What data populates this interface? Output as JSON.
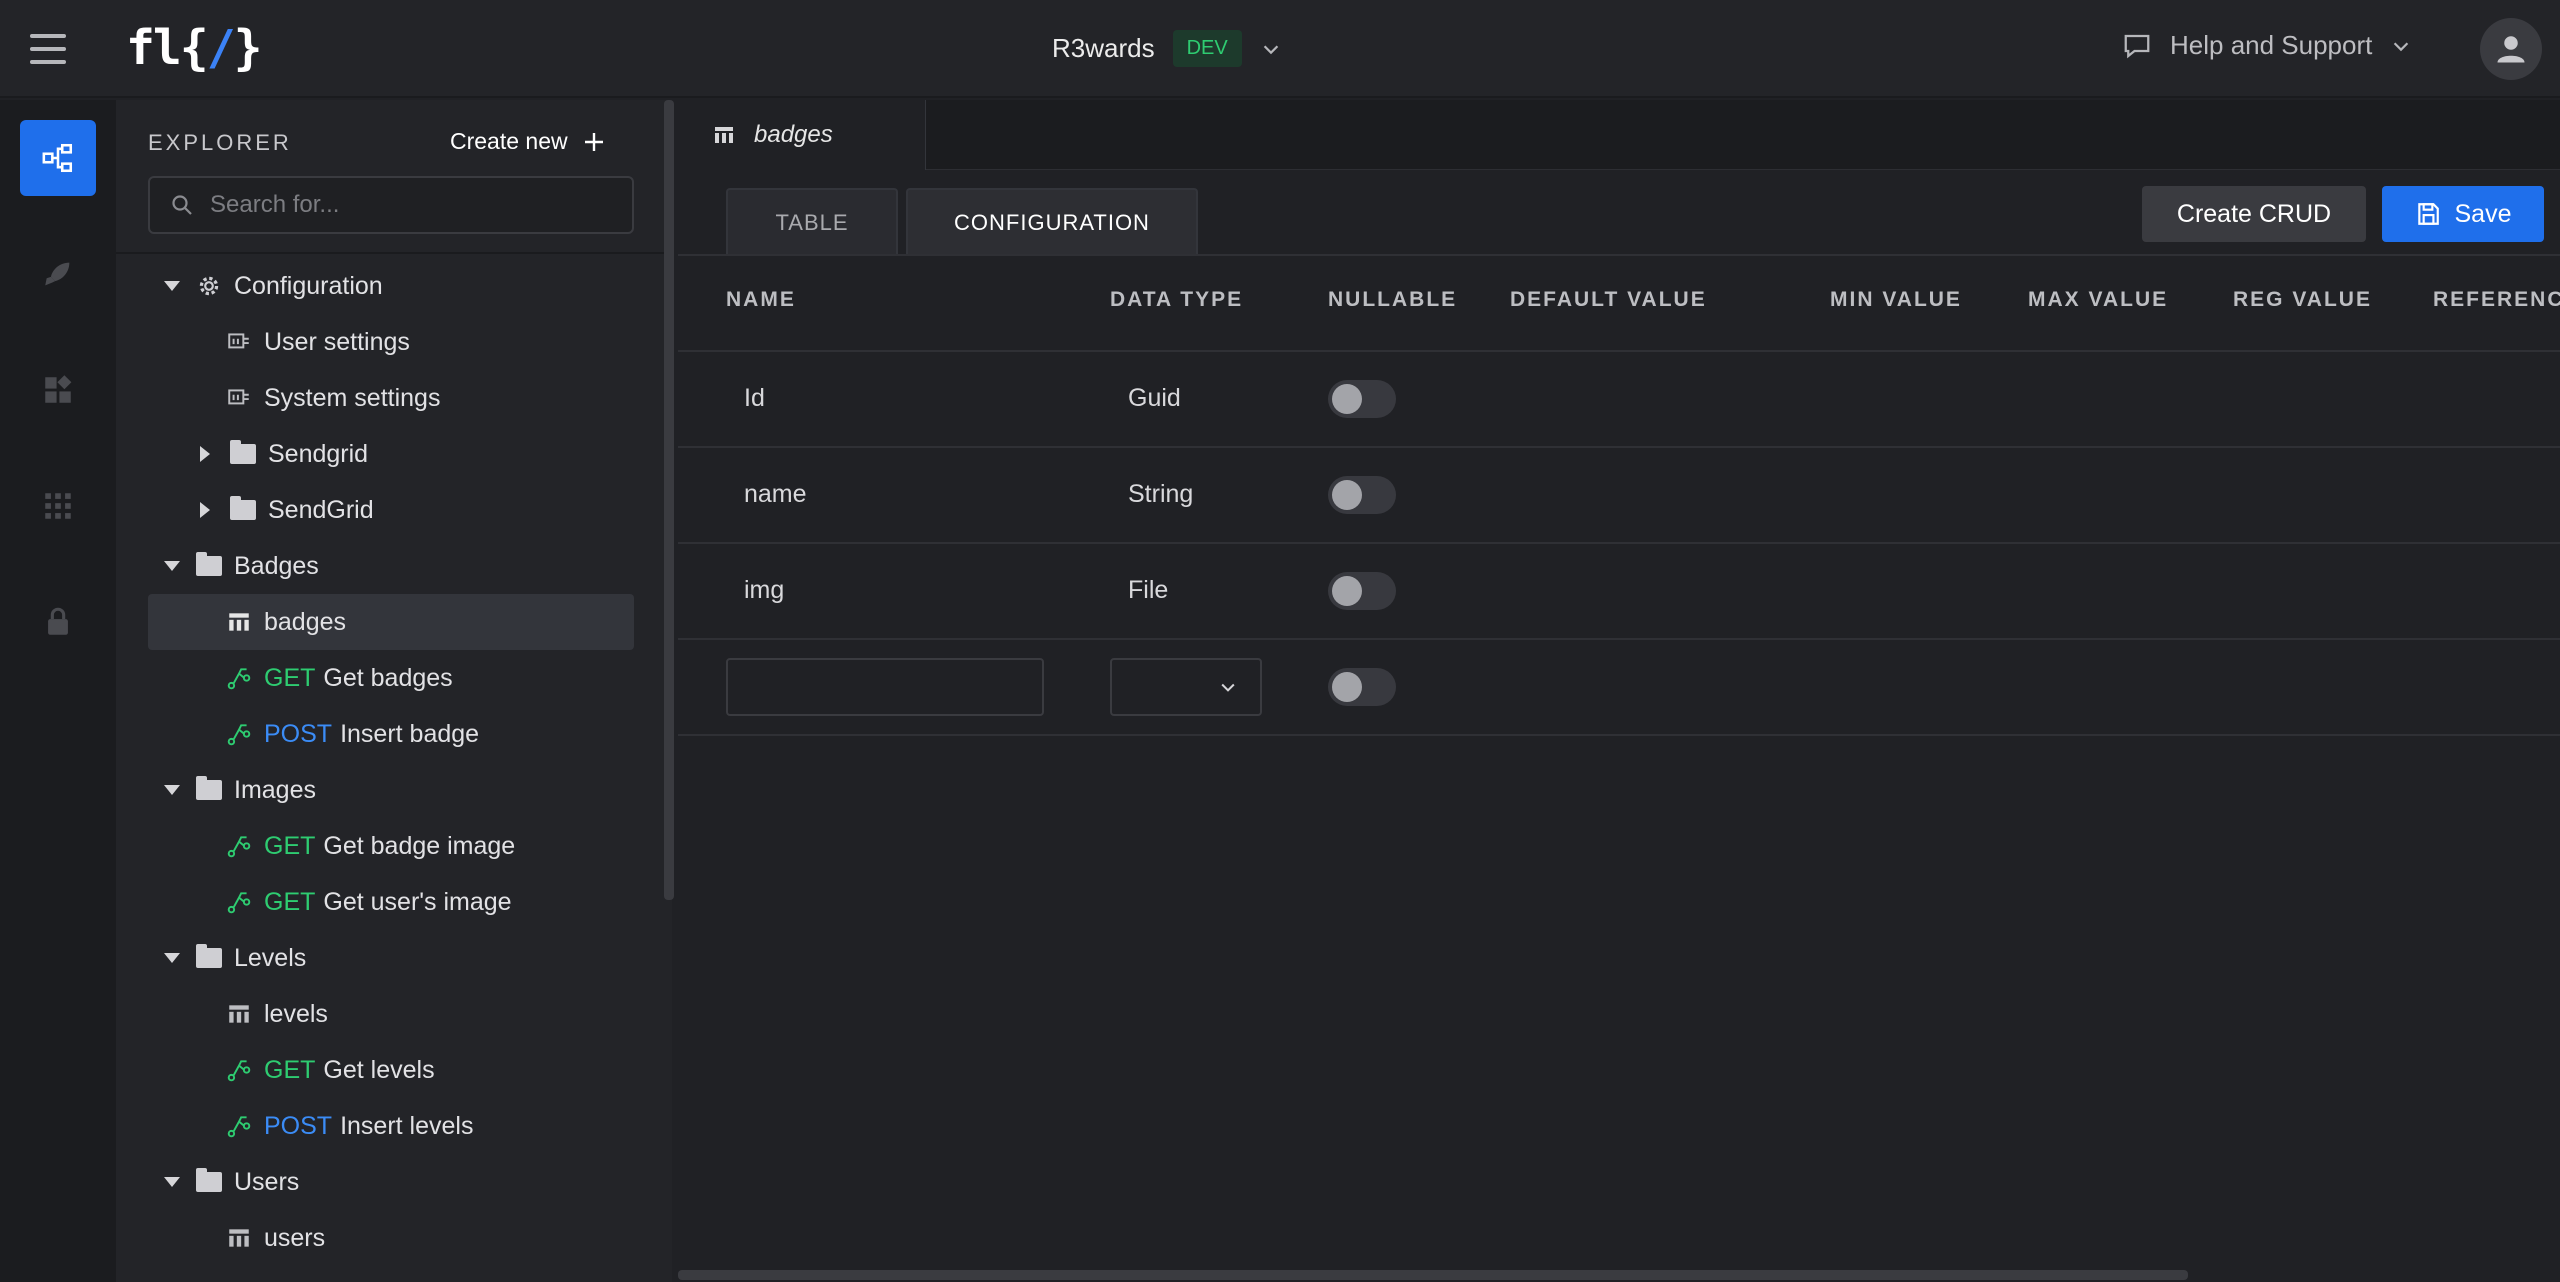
{
  "header": {
    "logo_text": "fl",
    "logo_brace_open": "{",
    "logo_slash": "/",
    "logo_brace_close": "}",
    "project_name": "R3wards",
    "env_badge": "DEV",
    "help_label": "Help and Support"
  },
  "rail": {
    "items": [
      {
        "icon": "explorer-icon",
        "active": true
      },
      {
        "icon": "rocket-icon",
        "active": false
      },
      {
        "icon": "widgets-icon",
        "active": false
      },
      {
        "icon": "apps-grid-icon",
        "active": false
      },
      {
        "icon": "lock-icon",
        "active": false
      }
    ]
  },
  "explorer": {
    "title": "EXPLORER",
    "create_new": "Create new",
    "search_placeholder": "Search for...",
    "tree": [
      {
        "label": "Configuration",
        "kind": "config-folder",
        "expanded": true
      },
      {
        "label": "User settings",
        "kind": "settings"
      },
      {
        "label": "System settings",
        "kind": "settings"
      },
      {
        "label": "Sendgrid",
        "kind": "folder",
        "expanded": false
      },
      {
        "label": "SendGrid",
        "kind": "folder",
        "expanded": false
      },
      {
        "label": "Badges",
        "kind": "folder",
        "expanded": true
      },
      {
        "label": "badges",
        "kind": "table",
        "selected": true
      },
      {
        "method": "GET",
        "label": "Get badges",
        "kind": "endpoint"
      },
      {
        "method": "POST",
        "label": "Insert badge",
        "kind": "endpoint"
      },
      {
        "label": "Images",
        "kind": "folder",
        "expanded": true
      },
      {
        "method": "GET",
        "label": "Get badge image",
        "kind": "endpoint"
      },
      {
        "method": "GET",
        "label": "Get user's image",
        "kind": "endpoint"
      },
      {
        "label": "Levels",
        "kind": "folder",
        "expanded": true
      },
      {
        "label": "levels",
        "kind": "table"
      },
      {
        "method": "GET",
        "label": "Get levels",
        "kind": "endpoint"
      },
      {
        "method": "POST",
        "label": "Insert levels",
        "kind": "endpoint"
      },
      {
        "label": "Users",
        "kind": "folder",
        "expanded": true
      },
      {
        "label": "users",
        "kind": "table"
      }
    ]
  },
  "editor": {
    "file_tab": "badges",
    "tabs": [
      "TABLE",
      "CONFIGURATION"
    ],
    "active_tab": "CONFIGURATION",
    "create_crud": "Create CRUD",
    "save": "Save",
    "columns": [
      "NAME",
      "DATA TYPE",
      "NULLABLE",
      "DEFAULT VALUE",
      "MIN VALUE",
      "MAX VALUE",
      "REG VALUE",
      "REFERENC"
    ],
    "rows": [
      {
        "name": "Id",
        "type": "Guid",
        "nullable": false
      },
      {
        "name": "name",
        "type": "String",
        "nullable": false
      },
      {
        "name": "img",
        "type": "File",
        "nullable": false
      }
    ],
    "new_row": {
      "name": "",
      "type": "",
      "nullable": false
    }
  },
  "colors": {
    "accent": "#1f6feb",
    "get": "#2ecc71",
    "post": "#3b8cf6",
    "env_badge": "#2ecc71"
  }
}
